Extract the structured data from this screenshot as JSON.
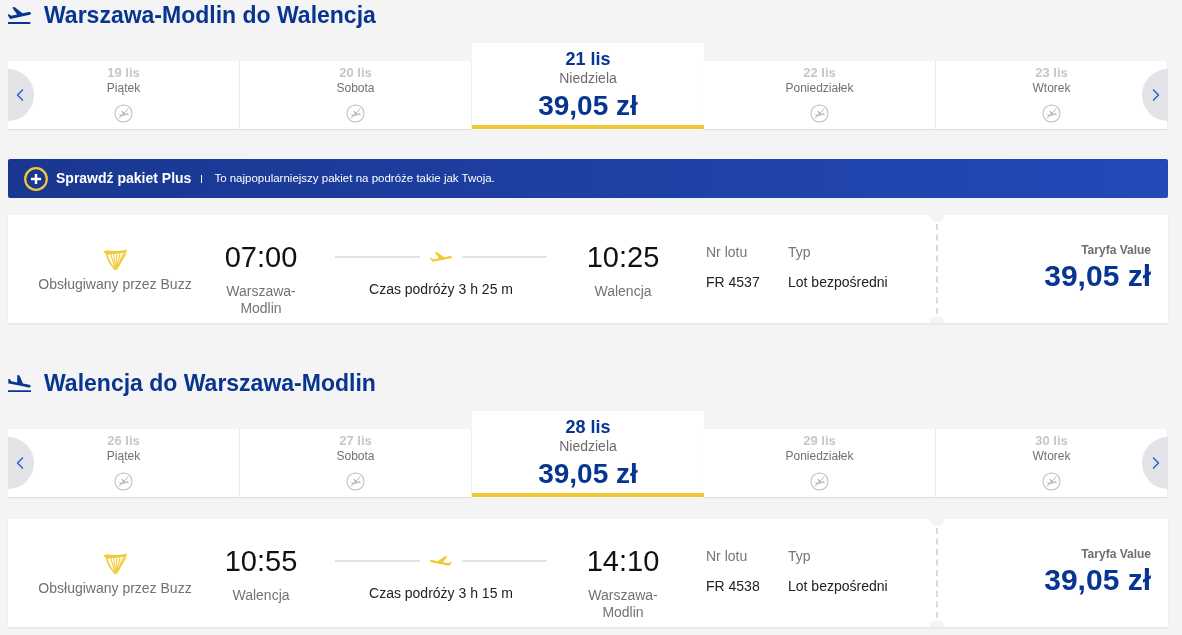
{
  "journeys": [
    {
      "kind": "outbound",
      "title": "Warszawa-Modlin do Walencja",
      "dates": [
        {
          "date": "19 lis",
          "weekday": "Piątek",
          "selected": false,
          "available": false
        },
        {
          "date": "20 lis",
          "weekday": "Sobota",
          "selected": false,
          "available": false
        },
        {
          "date": "21 lis",
          "weekday": "Niedziela",
          "price": "39,05 zł",
          "selected": true,
          "available": true
        },
        {
          "date": "22 lis",
          "weekday": "Poniedziałek",
          "selected": false,
          "available": false
        },
        {
          "date": "23 lis",
          "weekday": "Wtorek",
          "selected": false,
          "available": false
        }
      ],
      "promo_banner": {
        "title": "Sprawdź pakiet Plus",
        "text": "To najpopularniejszy pakiet na podróże takie jak Twoja."
      },
      "flight": {
        "operator": "Obsługiwany przez Buzz",
        "departure_time": "07:00",
        "departure_city": "Warszawa-Modlin",
        "duration": "Czas podróży 3 h 25 m",
        "arrival_time": "10:25",
        "arrival_city": "Walencja",
        "flight_number_label": "Nr lotu",
        "flight_number": "FR 4537",
        "type_label": "Typ",
        "type": "Lot bezpośredni",
        "fare_label": "Taryfa Value",
        "price": "39,05 zł"
      }
    },
    {
      "kind": "return",
      "title": "Walencja do Warszawa-Modlin",
      "dates": [
        {
          "date": "26 lis",
          "weekday": "Piątek",
          "selected": false,
          "available": false
        },
        {
          "date": "27 lis",
          "weekday": "Sobota",
          "selected": false,
          "available": false
        },
        {
          "date": "28 lis",
          "weekday": "Niedziela",
          "price": "39,05 zł",
          "selected": true,
          "available": true
        },
        {
          "date": "29 lis",
          "weekday": "Poniedziałek",
          "selected": false,
          "available": false
        },
        {
          "date": "30 lis",
          "weekday": "Wtorek",
          "selected": false,
          "available": false
        }
      ],
      "flight": {
        "operator": "Obsługiwany przez Buzz",
        "departure_time": "10:55",
        "departure_city": "Walencja",
        "duration": "Czas podróży 3 h 15 m",
        "arrival_time": "14:10",
        "arrival_city": "Warszawa-Modlin",
        "flight_number_label": "Nr lotu",
        "flight_number": "FR 4538",
        "type_label": "Typ",
        "type": "Lot bezpośredni",
        "fare_label": "Taryfa Value",
        "price": "39,05 zł"
      }
    }
  ]
}
